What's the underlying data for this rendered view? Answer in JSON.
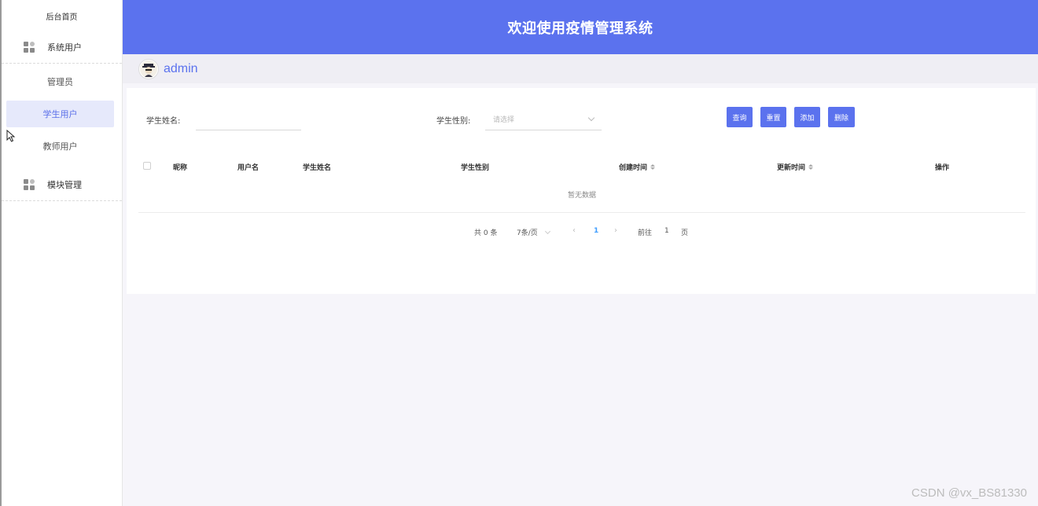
{
  "sidebar": {
    "home_label": "后台首页",
    "groups": [
      {
        "label": "系统用户",
        "icon": "grid-icon",
        "items": [
          {
            "label": "管理员",
            "active": false
          },
          {
            "label": "学生用户",
            "active": true
          },
          {
            "label": "教师用户",
            "active": false
          }
        ]
      },
      {
        "label": "模块管理",
        "icon": "grid-icon",
        "items": []
      }
    ]
  },
  "header": {
    "title": "欢迎使用疫情管理系统"
  },
  "user": {
    "name": "admin",
    "avatar_icon": "avatar-icon"
  },
  "search": {
    "name_label": "学生姓名:",
    "name_value": "",
    "gender_label": "学生性别:",
    "gender_placeholder": "请选择"
  },
  "buttons": {
    "query": "查询",
    "reset": "重置",
    "add": "添加",
    "delete": "删除"
  },
  "table": {
    "columns": [
      "昵称",
      "用户名",
      "学生姓名",
      "学生性别",
      "创建时间",
      "更新时间",
      "操作"
    ],
    "sortable": [
      "创建时间",
      "更新时间"
    ],
    "rows": [],
    "empty_text": "暂无数据"
  },
  "pagination": {
    "total_text": "共 0 条",
    "page_size": "7条/页",
    "current_page": "1",
    "goto_label": "前往",
    "goto_value": "1",
    "page_suffix": "页"
  },
  "watermark": "CSDN @vx_BS81330",
  "colors": {
    "primary": "#5b72ee",
    "active_bg": "#e6e9fb",
    "page_bg": "#f6f5fa",
    "pager_active": "#409eff"
  }
}
